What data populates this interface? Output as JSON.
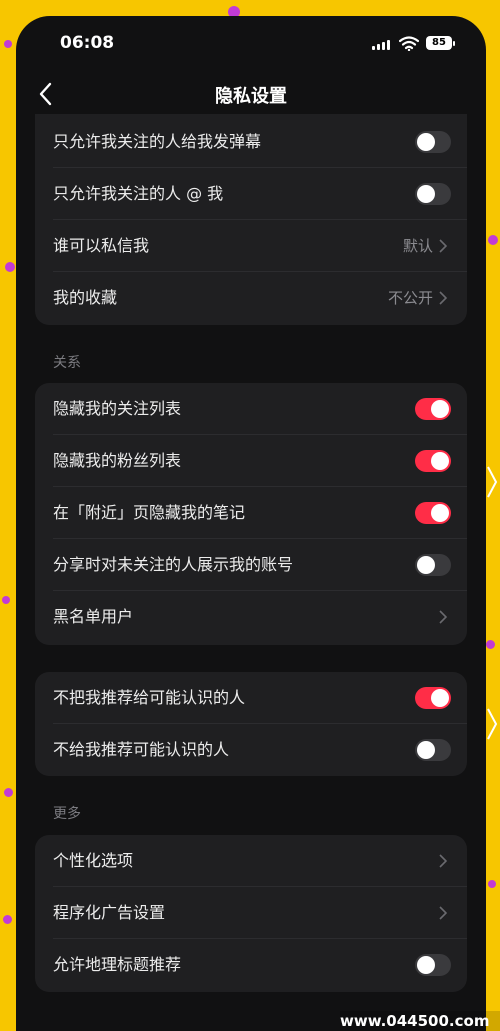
{
  "status_bar": {
    "time": "06:08",
    "battery": "85",
    "icons": [
      "signal-icon",
      "wifi-icon",
      "battery-icon"
    ]
  },
  "nav": {
    "title": "隐私设置",
    "back_icon": "chevron-left-icon"
  },
  "groups": [
    {
      "section_title": "",
      "rows": [
        {
          "label": "只允许我关注的人给我发弹幕",
          "type": "toggle",
          "on": false
        },
        {
          "label": "只允许我关注的人 @ 我",
          "type": "toggle",
          "on": false
        },
        {
          "label": "谁可以私信我",
          "type": "value",
          "value": "默认"
        },
        {
          "label": "我的收藏",
          "type": "value",
          "value": "不公开"
        }
      ]
    },
    {
      "section_title": "关系",
      "rows": [
        {
          "label": "隐藏我的关注列表",
          "type": "toggle",
          "on": true
        },
        {
          "label": "隐藏我的粉丝列表",
          "type": "toggle",
          "on": true
        },
        {
          "label": "在「附近」页隐藏我的笔记",
          "type": "toggle",
          "on": true
        },
        {
          "label": "分享时对未关注的人展示我的账号",
          "type": "toggle",
          "on": false
        },
        {
          "label": "黑名单用户",
          "type": "link"
        }
      ]
    },
    {
      "section_title": "",
      "rows": [
        {
          "label": "不把我推荐给可能认识的人",
          "type": "toggle",
          "on": true
        },
        {
          "label": "不给我推荐可能认识的人",
          "type": "toggle",
          "on": false
        }
      ]
    },
    {
      "section_title": "更多",
      "rows": [
        {
          "label": "个性化选项",
          "type": "link"
        },
        {
          "label": "程序化广告设置",
          "type": "link"
        },
        {
          "label": "允许地理标题推荐",
          "type": "toggle",
          "on": false
        }
      ]
    }
  ],
  "watermark": "www.044500.com",
  "colors": {
    "background": "#111112",
    "card": "#1f1f21",
    "toggle_on": "#ff2d47",
    "toggle_off": "#3a3a3d",
    "frame": "#f7c600",
    "frame_dots": "#c23bd4"
  }
}
